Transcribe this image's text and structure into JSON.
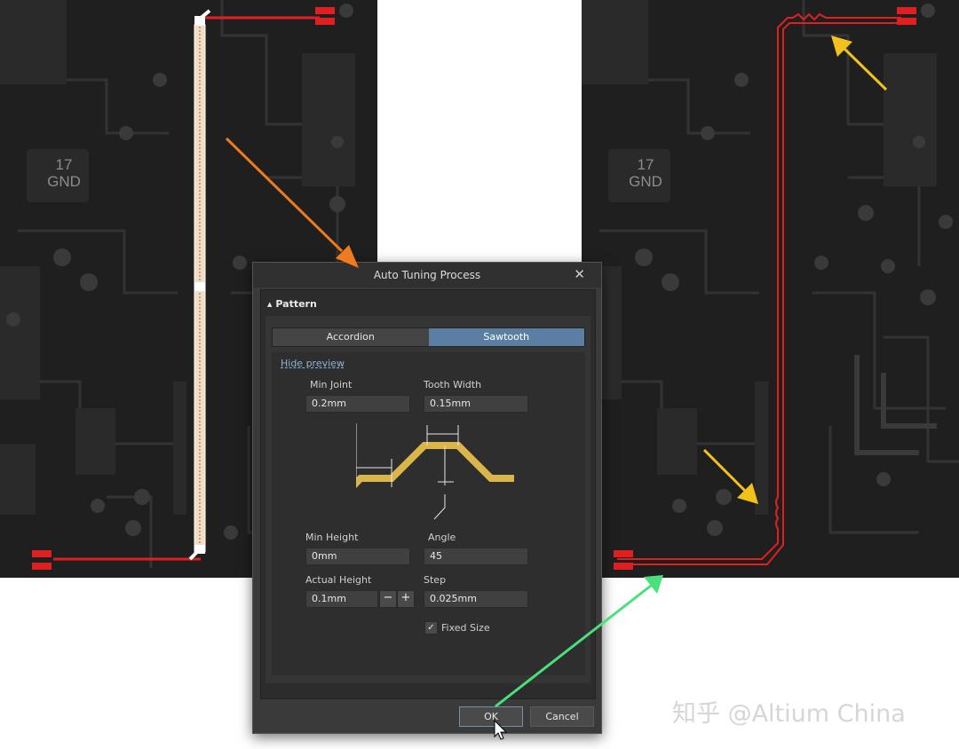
{
  "board": {
    "chip_number": "17",
    "chip_net": "GND"
  },
  "dialog": {
    "title": "Auto Tuning Process",
    "close_glyph": "✕",
    "section_title": "Pattern",
    "section_expander": "▲",
    "tabs": [
      {
        "label": "Accordion",
        "active": false
      },
      {
        "label": "Sawtooth",
        "active": true
      }
    ],
    "preview_link": "Hide preview",
    "fields": {
      "min_joint": {
        "label": "Min Joint",
        "value": "0.2mm"
      },
      "tooth_width": {
        "label": "Tooth Width",
        "value": "0.15mm"
      },
      "min_height": {
        "label": "Min Height",
        "value": "0mm"
      },
      "angle": {
        "label": "Angle",
        "value": "45"
      },
      "actual_height": {
        "label": "Actual Height",
        "value": "0.1mm"
      },
      "step": {
        "label": "Step",
        "value": "0.025mm"
      }
    },
    "stepper_minus": "−",
    "stepper_plus": "+",
    "fixed_size": {
      "label": "Fixed Size",
      "checked": true,
      "check_glyph": "✓"
    },
    "ok_label": "OK",
    "cancel_label": "Cancel"
  },
  "watermark": "知乎 @Altium China",
  "colors": {
    "trace": "#e02020",
    "selection": "#f3dcc4",
    "arrow_orange": "#f07a1e",
    "arrow_yellow": "#f2c21b",
    "arrow_green": "#4ae07a",
    "tab_active": "#5b7fa3",
    "preview_shape": "#d9b54a"
  }
}
